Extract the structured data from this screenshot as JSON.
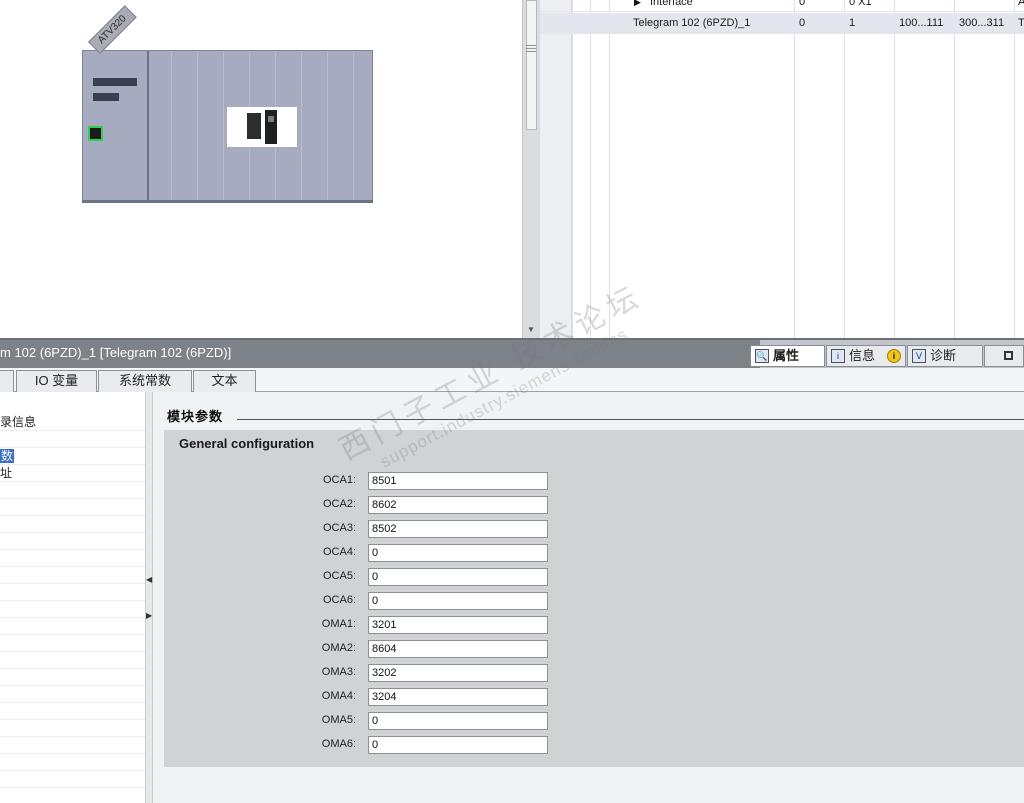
{
  "device_view": {
    "device_tag": "ATV320"
  },
  "grid": {
    "rows": [
      {
        "name": "Interface",
        "rack": "0",
        "slot": "0 X1",
        "i_addr": "",
        "q_addr": "",
        "type": "A"
      },
      {
        "name": "Telegram 102 (6PZD)_1",
        "rack": "0",
        "slot": "1",
        "i_addr": "100...111",
        "q_addr": "300...311",
        "type": "T"
      }
    ]
  },
  "properties": {
    "title": "m 102 (6PZD)_1 [Telegram 102 (6PZD)]",
    "tabs": [
      {
        "label": "属性",
        "icon": "properties-icon"
      },
      {
        "label": "信息",
        "icon": "info-icon"
      },
      {
        "label": "诊断",
        "icon": "diagnostics-icon"
      }
    ],
    "sub_tabs": [
      "",
      "IO 变量",
      "系统常数",
      "文本"
    ],
    "nav_items": [
      "录信息",
      "数",
      "址"
    ]
  },
  "main": {
    "section_title": "模块参数",
    "config_title": "General configuration",
    "params": [
      {
        "label": "OCA1:",
        "value": "8501"
      },
      {
        "label": "OCA2:",
        "value": "8602"
      },
      {
        "label": "OCA3:",
        "value": "8502"
      },
      {
        "label": "OCA4:",
        "value": "0"
      },
      {
        "label": "OCA5:",
        "value": "0"
      },
      {
        "label": "OCA6:",
        "value": "0"
      },
      {
        "label": "OMA1:",
        "value": "3201"
      },
      {
        "label": "OMA2:",
        "value": "8604"
      },
      {
        "label": "OMA3:",
        "value": "3202"
      },
      {
        "label": "OMA4:",
        "value": "3204"
      },
      {
        "label": "OMA5:",
        "value": "0"
      },
      {
        "label": "OMA6:",
        "value": "0"
      }
    ]
  },
  "watermark": {
    "cn": "西门子工业 技术论坛",
    "en": "support.industry.siemens.com/cs"
  }
}
